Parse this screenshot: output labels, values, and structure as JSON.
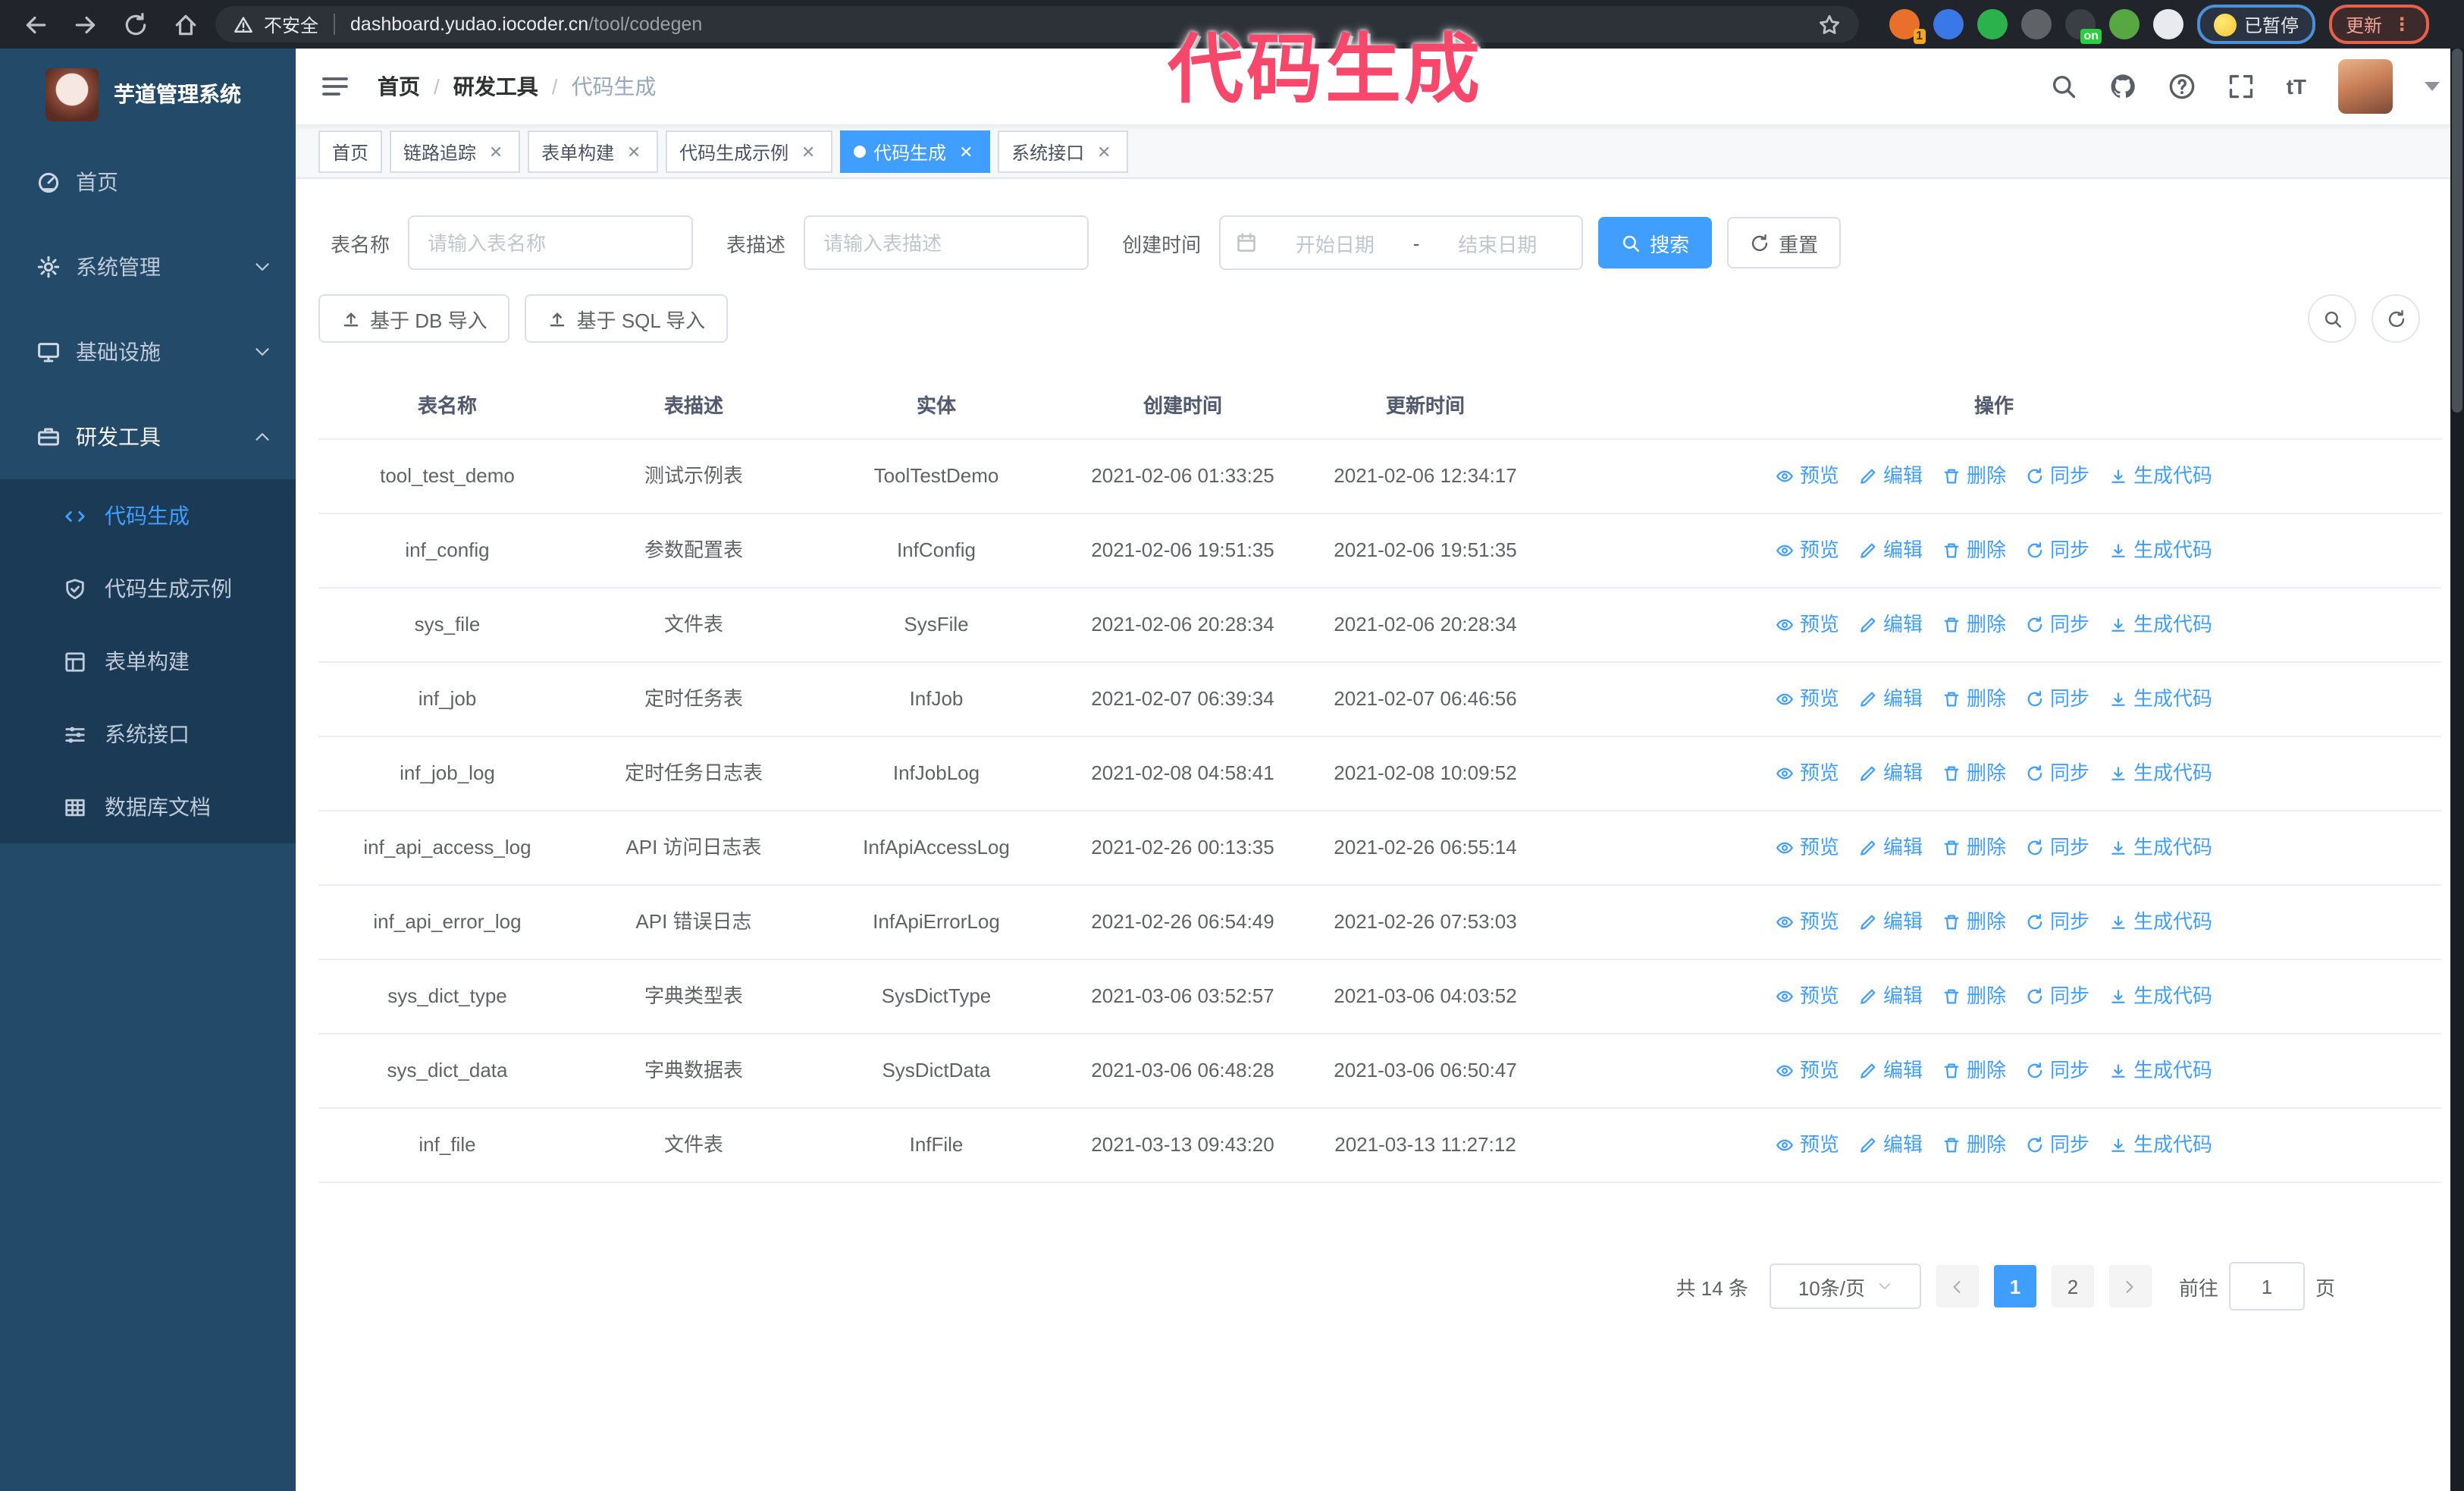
{
  "browser": {
    "security_label": "不安全",
    "url_host": "dashboard.yudao.iocoder.cn",
    "url_path": "/tool/codegen",
    "paused_badge": "已暂停",
    "update_button": "更新",
    "extensions": [
      {
        "icon": "sync-arrows-extension-icon",
        "color": "#e8702a",
        "badge": "1"
      },
      {
        "icon": "gem-extension-icon",
        "color": "#3b78e7",
        "badge": ""
      },
      {
        "icon": "shield-check-extension-icon",
        "color": "#2bb24c",
        "badge": ""
      },
      {
        "icon": "sliders-extension-icon",
        "color": "#5f6368",
        "badge": ""
      },
      {
        "icon": "panel-extension-icon",
        "color": "#3a3f45",
        "badge": "on"
      },
      {
        "icon": "bird-extension-icon",
        "color": "#57a843",
        "badge": ""
      },
      {
        "icon": "pinwheel-extension-icon",
        "color": "#e8eaed",
        "badge": ""
      }
    ]
  },
  "annotation": {
    "text": "代码生成",
    "color": "#f7476a"
  },
  "sidebar": {
    "logo_title": "芋道管理系统",
    "items": [
      {
        "label": "首页",
        "icon": "dashboard-icon",
        "chevron": "",
        "active": false
      },
      {
        "label": "系统管理",
        "icon": "gear-icon",
        "chevron": "down",
        "active": false
      },
      {
        "label": "基础设施",
        "icon": "monitor-icon",
        "chevron": "down",
        "active": false
      },
      {
        "label": "研发工具",
        "icon": "toolbox-icon",
        "chevron": "up",
        "active": true
      }
    ],
    "subitems": [
      {
        "label": "代码生成",
        "icon": "code-icon",
        "active": true
      },
      {
        "label": "代码生成示例",
        "icon": "check-badge-icon",
        "active": false
      },
      {
        "label": "表单构建",
        "icon": "form-icon",
        "active": false
      },
      {
        "label": "系统接口",
        "icon": "sliders-icon",
        "active": false
      },
      {
        "label": "数据库文档",
        "icon": "table-icon",
        "active": false
      }
    ]
  },
  "header": {
    "breadcrumb": {
      "0": "首页",
      "1": "研发工具",
      "2": "代码生成"
    },
    "font_size_icon_text": "tT"
  },
  "tabs": [
    {
      "label": "首页",
      "closable": false,
      "active": false
    },
    {
      "label": "链路追踪",
      "closable": true,
      "active": false
    },
    {
      "label": "表单构建",
      "closable": true,
      "active": false
    },
    {
      "label": "代码生成示例",
      "closable": true,
      "active": false
    },
    {
      "label": "代码生成",
      "closable": true,
      "active": true
    },
    {
      "label": "系统接口",
      "closable": true,
      "active": false
    }
  ],
  "search": {
    "name_label": "表名称",
    "name_placeholder": "请输入表名称",
    "desc_label": "表描述",
    "desc_placeholder": "请输入表描述",
    "time_label": "创建时间",
    "start_placeholder": "开始日期",
    "separator": "-",
    "end_placeholder": "结束日期",
    "search_button": "搜索",
    "reset_button": "重置"
  },
  "toolbar": {
    "import_db_button": "基于 DB 导入",
    "import_sql_button": "基于 SQL 导入"
  },
  "table": {
    "columns": [
      "表名称",
      "表描述",
      "实体",
      "创建时间",
      "更新时间",
      "操作"
    ],
    "actions": [
      {
        "label": "预览",
        "icon": "eye-icon"
      },
      {
        "label": "编辑",
        "icon": "pencil-icon"
      },
      {
        "label": "删除",
        "icon": "trash-icon"
      },
      {
        "label": "同步",
        "icon": "sync-icon"
      },
      {
        "label": "生成代码",
        "icon": "download-icon"
      }
    ],
    "rows": [
      {
        "name": "tool_test_demo",
        "desc": "测试示例表",
        "entity": "ToolTestDemo",
        "created": "2021-02-06 01:33:25",
        "updated": "2021-02-06 12:34:17"
      },
      {
        "name": "inf_config",
        "desc": "参数配置表",
        "entity": "InfConfig",
        "created": "2021-02-06 19:51:35",
        "updated": "2021-02-06 19:51:35"
      },
      {
        "name": "sys_file",
        "desc": "文件表",
        "entity": "SysFile",
        "created": "2021-02-06 20:28:34",
        "updated": "2021-02-06 20:28:34"
      },
      {
        "name": "inf_job",
        "desc": "定时任务表",
        "entity": "InfJob",
        "created": "2021-02-07 06:39:34",
        "updated": "2021-02-07 06:46:56"
      },
      {
        "name": "inf_job_log",
        "desc": "定时任务日志表",
        "entity": "InfJobLog",
        "created": "2021-02-08 04:58:41",
        "updated": "2021-02-08 10:09:52"
      },
      {
        "name": "inf_api_access_log",
        "desc": "API 访问日志表",
        "entity": "InfApiAccessLog",
        "created": "2021-02-26 00:13:35",
        "updated": "2021-02-26 06:55:14"
      },
      {
        "name": "inf_api_error_log",
        "desc": "API 错误日志",
        "entity": "InfApiErrorLog",
        "created": "2021-02-26 06:54:49",
        "updated": "2021-02-26 07:53:03"
      },
      {
        "name": "sys_dict_type",
        "desc": "字典类型表",
        "entity": "SysDictType",
        "created": "2021-03-06 03:52:57",
        "updated": "2021-03-06 04:03:52"
      },
      {
        "name": "sys_dict_data",
        "desc": "字典数据表",
        "entity": "SysDictData",
        "created": "2021-03-06 06:48:28",
        "updated": "2021-03-06 06:50:47"
      },
      {
        "name": "inf_file",
        "desc": "文件表",
        "entity": "InfFile",
        "created": "2021-03-13 09:43:20",
        "updated": "2021-03-13 11:27:12"
      }
    ]
  },
  "pagination": {
    "total": "共 14 条",
    "page_size": "10条/页",
    "pages": [
      "1",
      "2"
    ],
    "current": "1",
    "goto_label": "前往",
    "goto_value": "1",
    "page_label": "页"
  },
  "colors": {
    "primary": "#409eff",
    "sidebar_bg": "#234a68",
    "submenu_bg": "#1b3a55",
    "annotation_pink": "#f7476a"
  }
}
